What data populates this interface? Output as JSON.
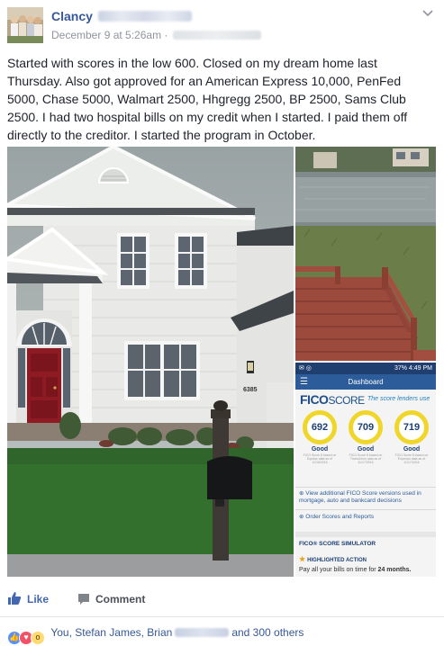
{
  "post": {
    "author": "Clancy",
    "timestamp": "December 9 at 5:26am",
    "timestamp_sep": "·",
    "text": "Started with scores in the low 600. Closed on my dream home last Thursday. Also got approved for an American Express 10,000, PenFed 5000, Chase 5000, Walmart 2500, Hhgregg 2500, BP 2500, Sams Club 2500. I had two hospital bills on my credit when I started. I paid them off directly to the creditor. I started the program in October."
  },
  "house": {
    "number": "6385"
  },
  "phone": {
    "status_time": "4:49 PM",
    "status_battery": "37%",
    "title": "Dashboard",
    "fico_logo": "FICO",
    "fico_score_word": "SCORE",
    "tagline": "The score lenders use",
    "scores": [
      {
        "value": "692",
        "label": "Good",
        "note": "FICO Score 8 based on Equifax data as of 11/18/2016"
      },
      {
        "value": "709",
        "label": "Good",
        "note": "FICO Score 8 based on TransUnion data as of 11/17/2016"
      },
      {
        "value": "719",
        "label": "Good",
        "note": "FICO Score 8 based on Experian data as of 11/17/2016"
      }
    ],
    "link_versions": "View additional FICO Score versions used in mortgage, auto and bankcard decisions",
    "link_order": "Order Scores and Reports",
    "simulator": "FICO® SCORE SIMULATOR",
    "highlighted": "HIGHLIGHTED ACTION",
    "pay_text": "Pay all your bills on time for ",
    "pay_bold": "24 months."
  },
  "actions": {
    "like": "Like",
    "comment": "Comment"
  },
  "reactions": {
    "names_prefix": "You, Stefan James, Brian",
    "names_suffix": "and 300 others"
  },
  "icons": {
    "chevron": "chevron-down-icon",
    "like": "thumbs-up-icon",
    "comment": "comment-bubble-icon"
  },
  "colors": {
    "link": "#365899",
    "like_blue": "#4267b2",
    "meta": "#90949c",
    "fico_ring": "#f0d62a"
  }
}
